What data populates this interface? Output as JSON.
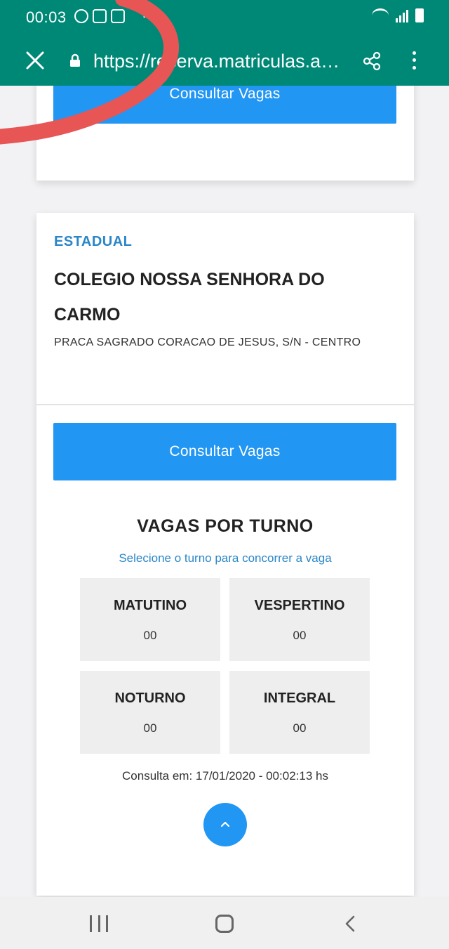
{
  "status_bar": {
    "time": "00:03",
    "dots": "··"
  },
  "browser": {
    "url": "https://reserva.matriculas.am...."
  },
  "top_card": {
    "button_label": "Consultar Vagas"
  },
  "school_card": {
    "kind": "ESTADUAL",
    "name": "COLEGIO NOSSA SENHORA DO CARMO",
    "address": "PRACA SAGRADO CORACAO DE JESUS, S/N - CENTRO",
    "button_label": "Consultar Vagas",
    "vagas_title": "VAGAS POR TURNO",
    "vagas_subtitle": "Selecione o turno para concorrer a vaga",
    "shifts": [
      {
        "name": "MATUTINO",
        "count": "00"
      },
      {
        "name": "VESPERTINO",
        "count": "00"
      },
      {
        "name": "NOTURNO",
        "count": "00"
      },
      {
        "name": "INTEGRAL",
        "count": "00"
      }
    ],
    "consulta": "Consulta em: 17/01/2020 - 00:02:13 hs"
  },
  "colors": {
    "header": "#008877",
    "primary": "#2196f3",
    "accent_text": "#2a86c8",
    "annotation": "#e85555"
  },
  "icons": {
    "close": "close-icon",
    "lock": "lock-icon",
    "share": "share-icon",
    "more": "more-vert-icon",
    "up": "chevron-up-icon"
  }
}
